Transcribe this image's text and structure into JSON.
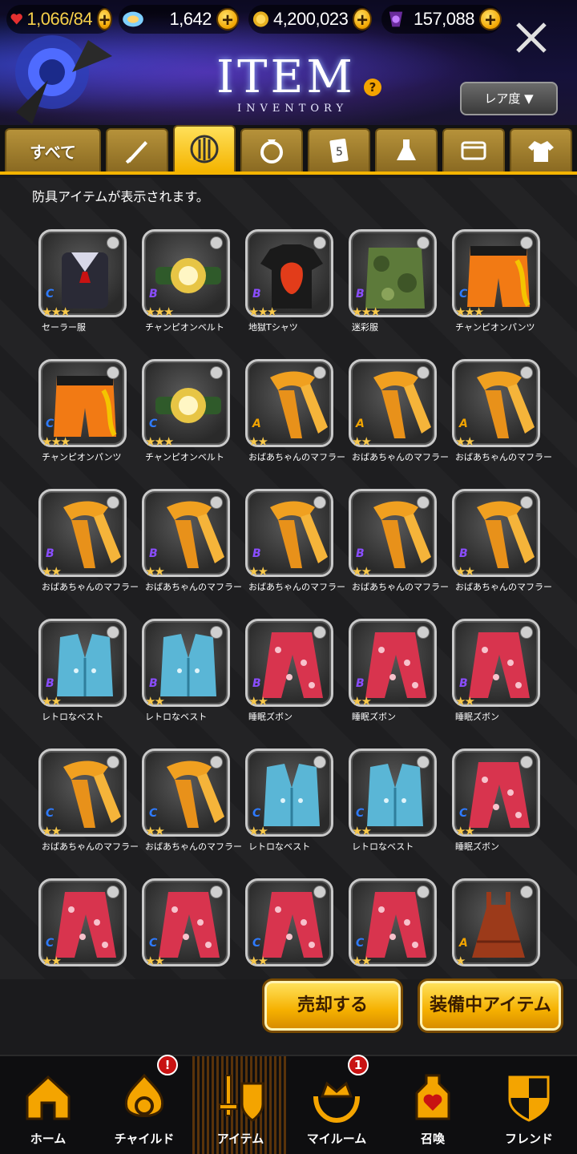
{
  "resources": {
    "heart": {
      "value": "1,066",
      "max": "/84",
      "icon": "heart-icon"
    },
    "gem": {
      "value": "1,642",
      "icon": "rainbow-gem-icon"
    },
    "coin": {
      "value": "4,200,023",
      "icon": "gold-coin-icon"
    },
    "potion": {
      "value": "157,088",
      "icon": "purple-potion-icon"
    }
  },
  "header": {
    "title": "ITEM",
    "subtitle": "INVENTORY",
    "help": "?",
    "rarity_button": "レア度 ▼"
  },
  "tabs": [
    {
      "label": "すべて",
      "icon": "all"
    },
    {
      "icon": "sword-icon"
    },
    {
      "icon": "shield-icon",
      "active": true
    },
    {
      "icon": "ring-icon"
    },
    {
      "icon": "card-icon"
    },
    {
      "icon": "flask-icon"
    },
    {
      "icon": "wallet-icon"
    },
    {
      "icon": "shirt-icon"
    }
  ],
  "description": "防具アイテムが表示されます。",
  "items": [
    {
      "name": "セーラー服",
      "stars": "★★★",
      "rank": "C",
      "art": "sailor"
    },
    {
      "name": "チャンピオンベルト",
      "stars": "★★★",
      "rank": "B",
      "art": "belt"
    },
    {
      "name": "地獄Tシャツ",
      "stars": "★★★",
      "rank": "B",
      "art": "tshirt"
    },
    {
      "name": "迷彩服",
      "stars": "★★★",
      "rank": "B",
      "art": "camo"
    },
    {
      "name": "チャンピオンパンツ",
      "stars": "★★★",
      "rank": "C",
      "art": "shorts"
    },
    {
      "name": "チャンピオンパンツ",
      "stars": "★★★",
      "rank": "C",
      "art": "shorts"
    },
    {
      "name": "チャンピオンベルト",
      "stars": "★★★",
      "rank": "C",
      "art": "belt"
    },
    {
      "name": "おばあちゃんのマフラー",
      "stars": "★★",
      "rank": "A",
      "art": "scarf"
    },
    {
      "name": "おばあちゃんのマフラー",
      "stars": "★★",
      "rank": "A",
      "art": "scarf"
    },
    {
      "name": "おばあちゃんのマフラー",
      "stars": "★★",
      "rank": "A",
      "art": "scarf"
    },
    {
      "name": "おばあちゃんのマフラー",
      "stars": "★★",
      "rank": "B",
      "art": "scarf"
    },
    {
      "name": "おばあちゃんのマフラー",
      "stars": "★★",
      "rank": "B",
      "art": "scarf"
    },
    {
      "name": "おばあちゃんのマフラー",
      "stars": "★★",
      "rank": "B",
      "art": "scarf"
    },
    {
      "name": "おばあちゃんのマフラー",
      "stars": "★★",
      "rank": "B",
      "art": "scarf"
    },
    {
      "name": "おばあちゃんのマフラー",
      "stars": "★★",
      "rank": "B",
      "art": "scarf"
    },
    {
      "name": "レトロなベスト",
      "stars": "★★",
      "rank": "B",
      "art": "vest"
    },
    {
      "name": "レトロなベスト",
      "stars": "★★",
      "rank": "B",
      "art": "vest"
    },
    {
      "name": "睡眠ズボン",
      "stars": "★★",
      "rank": "B",
      "art": "pants"
    },
    {
      "name": "睡眠ズボン",
      "stars": "★★",
      "rank": "B",
      "art": "pants"
    },
    {
      "name": "睡眠ズボン",
      "stars": "★★",
      "rank": "B",
      "art": "pants"
    },
    {
      "name": "おばあちゃんのマフラー",
      "stars": "★★",
      "rank": "C",
      "art": "scarf"
    },
    {
      "name": "おばあちゃんのマフラー",
      "stars": "★★",
      "rank": "C",
      "art": "scarf"
    },
    {
      "name": "レトロなベスト",
      "stars": "★★",
      "rank": "C",
      "art": "vest"
    },
    {
      "name": "レトロなベスト",
      "stars": "★★",
      "rank": "C",
      "art": "vest"
    },
    {
      "name": "睡眠ズボン",
      "stars": "★★",
      "rank": "C",
      "art": "pants"
    },
    {
      "name": "",
      "stars": "★★",
      "rank": "C",
      "art": "pants"
    },
    {
      "name": "",
      "stars": "★★",
      "rank": "C",
      "art": "pants"
    },
    {
      "name": "",
      "stars": "★★",
      "rank": "C",
      "art": "pants"
    },
    {
      "name": "",
      "stars": "★★",
      "rank": "C",
      "art": "pants"
    },
    {
      "name": "",
      "stars": "★",
      "rank": "A",
      "art": "dress"
    }
  ],
  "actions": {
    "sell": "売却する",
    "equipped": "装備中アイテム"
  },
  "nav": [
    {
      "label": "ホーム",
      "icon": "home-icon"
    },
    {
      "label": "チャイルド",
      "icon": "child-icon",
      "badge": "!"
    },
    {
      "label": "アイテム",
      "icon": "item-icon",
      "active": true
    },
    {
      "label": "マイルーム",
      "icon": "myroom-icon",
      "badge": "1"
    },
    {
      "label": "召喚",
      "icon": "summon-icon"
    },
    {
      "label": "フレンド",
      "icon": "friend-icon"
    }
  ],
  "colors": {
    "accent": "#f4b400",
    "rank_A": "#f2a400",
    "rank_B": "#8a4dff",
    "rank_C": "#2e7bff",
    "badge": "#c81212"
  }
}
